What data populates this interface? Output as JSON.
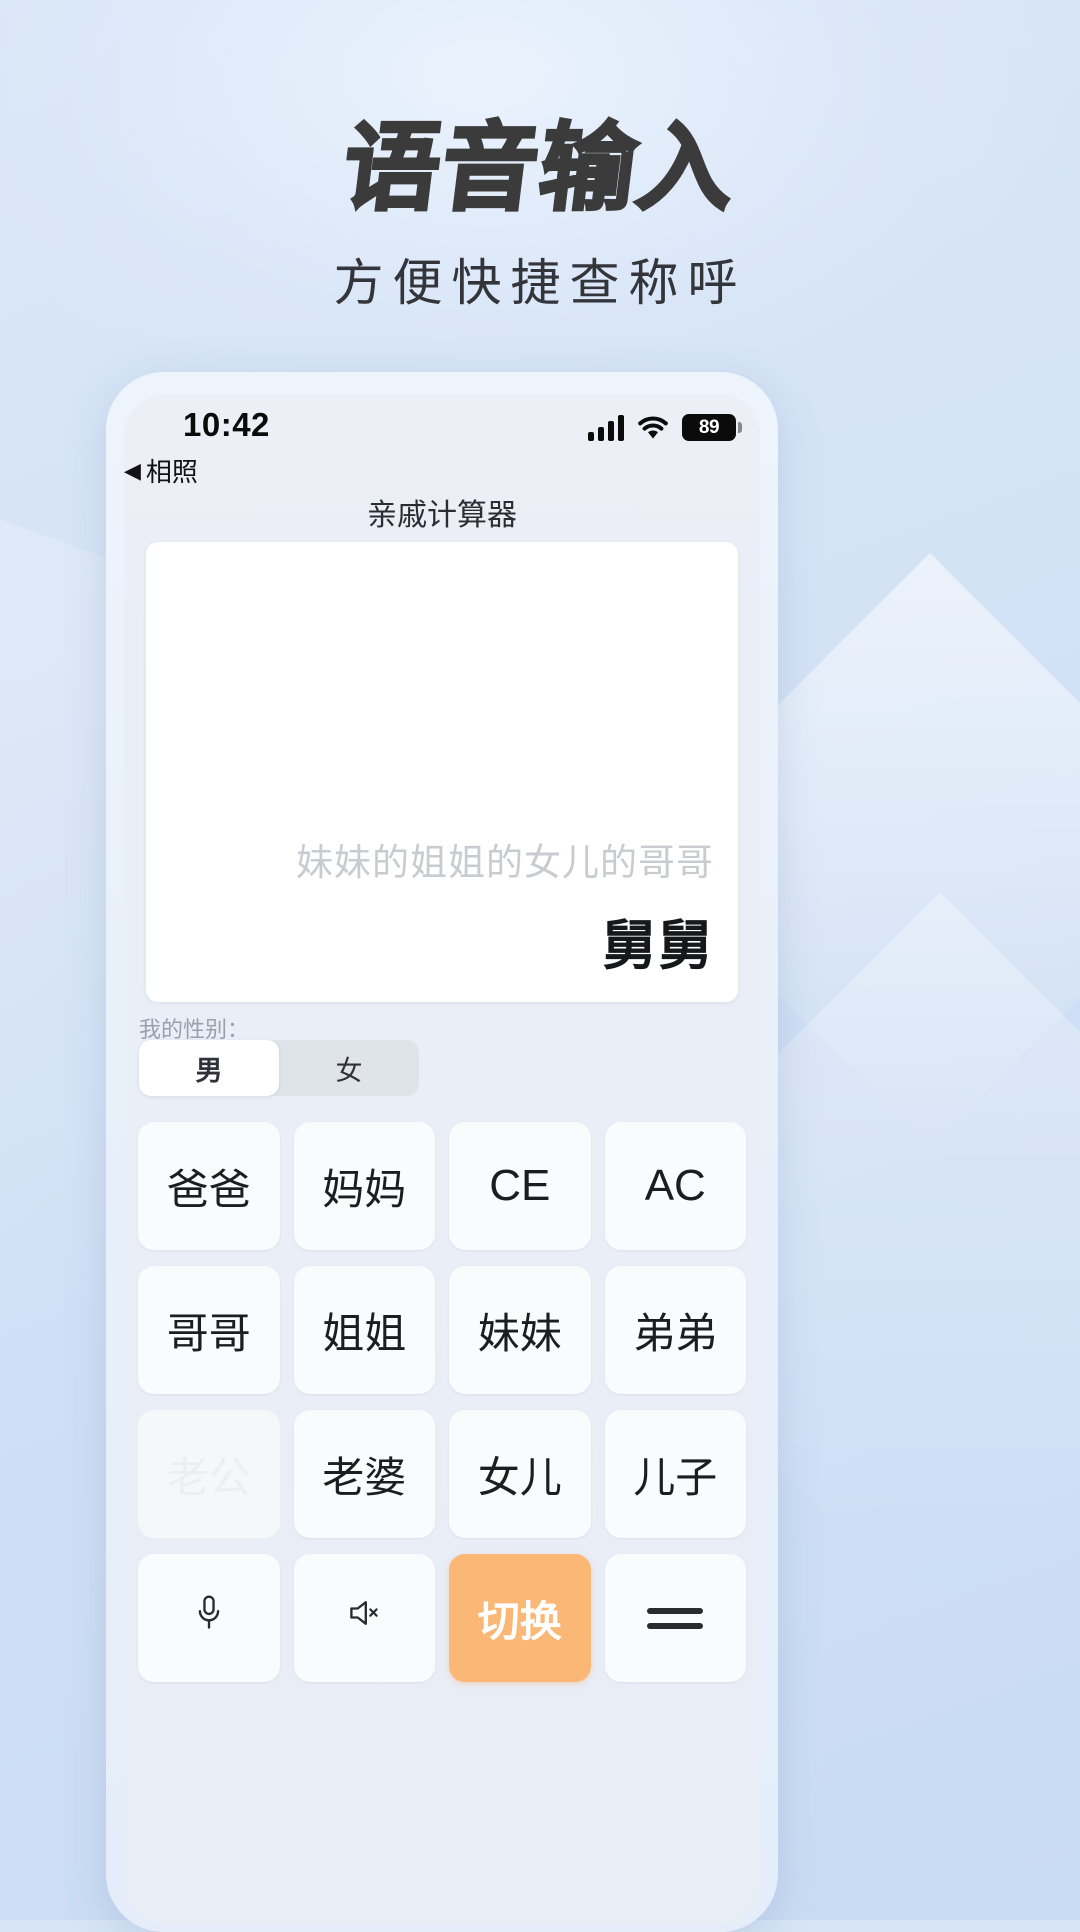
{
  "promo": {
    "headline": "语音输入",
    "subhead": "方便快捷查称呼"
  },
  "colors": {
    "accent": "#FBB775",
    "background": "#D8E5F7",
    "text": "#3B3B3B",
    "placeholder": "#C9CBD0"
  },
  "status_bar": {
    "time": "10:42",
    "back_caret": "◀",
    "back_label": "相照",
    "signal_icon": "signal-bars-icon",
    "wifi_icon": "wifi-icon",
    "battery_level": "89"
  },
  "app": {
    "title": "亲戚计算器",
    "display": {
      "expression": "妹妹的姐姐的女儿的哥哥",
      "result": "舅舅"
    },
    "gender": {
      "label": "我的性别：",
      "options": [
        {
          "label": "男",
          "selected": true
        },
        {
          "label": "女",
          "selected": false
        }
      ]
    },
    "keypad": [
      {
        "label": "爸爸",
        "type": "relation"
      },
      {
        "label": "妈妈",
        "type": "relation"
      },
      {
        "label": "CE",
        "type": "latin"
      },
      {
        "label": "AC",
        "type": "latin"
      },
      {
        "label": "哥哥",
        "type": "relation"
      },
      {
        "label": "姐姐",
        "type": "relation"
      },
      {
        "label": "妹妹",
        "type": "relation"
      },
      {
        "label": "弟弟",
        "type": "relation"
      },
      {
        "label": "老公",
        "type": "disabled"
      },
      {
        "label": "老婆",
        "type": "relation"
      },
      {
        "label": "女儿",
        "type": "relation"
      },
      {
        "label": "儿子",
        "type": "relation"
      },
      {
        "label": "",
        "type": "mic",
        "icon": "microphone-icon"
      },
      {
        "label": "",
        "type": "mute",
        "icon": "speaker-mute-icon"
      },
      {
        "label": "切换",
        "type": "accent"
      },
      {
        "label": "",
        "type": "equals",
        "icon": "equals-icon"
      }
    ]
  }
}
